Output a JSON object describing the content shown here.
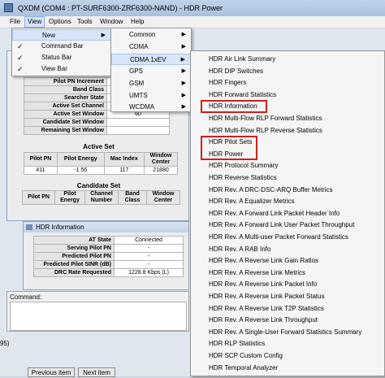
{
  "window": {
    "title": "QXDM (COM4 : PT-SURF6300-ZRF6300-NAND) - HDR Power"
  },
  "menubar": [
    "File",
    "View",
    "Options",
    "Tools",
    "Window",
    "Help"
  ],
  "view_menu": {
    "items": [
      {
        "label": "New",
        "checked": false,
        "submenu": true
      },
      {
        "label": "Command Bar",
        "checked": true,
        "submenu": false
      },
      {
        "label": "Status Bar",
        "checked": true,
        "submenu": false
      },
      {
        "label": "View Bar",
        "checked": true,
        "submenu": false
      }
    ]
  },
  "new_submenu": [
    "Common",
    "CDMA",
    "CDMA 1xEV",
    "GPS",
    "GSM",
    "UMTS",
    "WCDMA"
  ],
  "ev_submenu": [
    "HDR Air Link Summary",
    "HDR DIP Switches",
    "HDR Fingers",
    "HDR Forward Statistics",
    "HDR Information",
    "HDR Multi-Flow RLP Forward Statistics",
    "HDR Multi-Flow RLP Reverse Statistics",
    "HDR Pilot Sets",
    "HDR Power",
    "HDR Protocol Summary",
    "HDR Reverse Statistics",
    "HDR Rev. A DRC-DSC-ARQ Buffer Metrics",
    "HDR Rev. A Equalizer Metrics",
    "HDR Rev. A Forward Link Packet Header Info",
    "HDR Rev. A Forward Link User Packet Throughput",
    "HDR Rev. A Multi-user Packet Forward Statistics",
    "HDR Rev. A RAB Info",
    "HDR Rev. A Reverse Link Gain Ratios",
    "HDR Rev. A Reverse Link Metrics",
    "HDR Rev. A Reverse Link Packet Info",
    "HDR Rev. A Reverse Link Packet Status",
    "HDR Rev. A Reverse Link T2P Statistics",
    "HDR Rev. A Reverse Link Throughput",
    "HDR Rev. A Single-User Forward Statistics Summary",
    "HDR RLP Statistics",
    "HDR SCP Custom Config",
    "HDR Temporal Analyzer"
  ],
  "pilot_window": {
    "rows": [
      {
        "label": "Pilot PN Increment",
        "value": ""
      },
      {
        "label": "Band Class",
        "value": ""
      },
      {
        "label": "Searcher State",
        "value": ""
      },
      {
        "label": "Active Set Channel",
        "value": ""
      },
      {
        "label": "Active Set Window",
        "value": "60"
      },
      {
        "label": "Candidate Set Window",
        "value": ""
      },
      {
        "label": "Remaining Set Window",
        "value": ""
      }
    ],
    "active_set_title": "Active Set",
    "active_headers": [
      "Pilot PN",
      "Pilot Energy",
      "Mac Index",
      "Window Center"
    ],
    "active_rows": [
      [
        "411",
        "-1.56",
        "117",
        "21880"
      ]
    ],
    "candidate_set_title": "Candidate Set",
    "candidate_headers": [
      "Pilot PN",
      "Pilot Energy",
      "Channel Number",
      "Band Class",
      "Window Center"
    ]
  },
  "info_window": {
    "title": "HDR Information",
    "rows": [
      {
        "label": "AT State",
        "value": "Connected"
      },
      {
        "label": "Serving Pilot PN",
        "value": "-"
      },
      {
        "label": "Predicted Pilot PN",
        "value": "-"
      },
      {
        "label": "Predicted Pilot SINR (dB)",
        "value": "-"
      },
      {
        "label": "DRC Rate Requested",
        "value": "1228.8 Kbps (L)"
      }
    ]
  },
  "command_bar": {
    "label": "Command:"
  },
  "left_fragment": "95)",
  "buttons": {
    "prev": "Previous item",
    "next": "Next item"
  },
  "colors": {
    "highlight_border": "#d21e1e",
    "menu_highlight": "#d6e6f8"
  }
}
